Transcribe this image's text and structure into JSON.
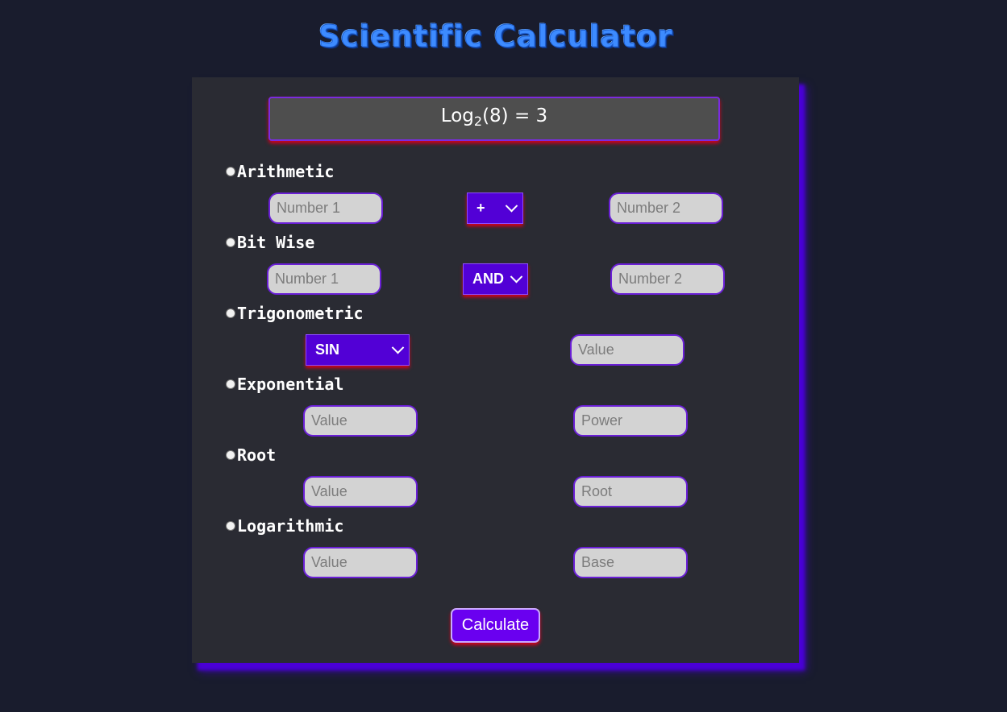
{
  "title": "Scientific Calculator",
  "display": {
    "pre": "Log",
    "base": "2",
    "post": "(8) = 3"
  },
  "sections": {
    "arithmetic": {
      "label": "Arithmetic",
      "input1_placeholder": "Number 1",
      "operator": "+",
      "input2_placeholder": "Number 2"
    },
    "bitwise": {
      "label": "Bit Wise",
      "input1_placeholder": "Number 1",
      "operator": "AND",
      "input2_placeholder": "Number 2"
    },
    "trigonometric": {
      "label": "Trigonometric",
      "function": "SIN",
      "value_placeholder": "Value"
    },
    "exponential": {
      "label": "Exponential",
      "value_placeholder": "Value",
      "power_placeholder": "Power"
    },
    "root": {
      "label": "Root",
      "value_placeholder": "Value",
      "root_placeholder": "Root"
    },
    "logarithmic": {
      "label": "Logarithmic",
      "value_placeholder": "Value",
      "base_placeholder": "Base"
    }
  },
  "calculate_label": "Calculate",
  "colors": {
    "background": "#191c2d",
    "panel": "#2a2b33",
    "accent": "#5200d6",
    "title": "#3d8bff",
    "shadow_red": "#d4001e"
  }
}
